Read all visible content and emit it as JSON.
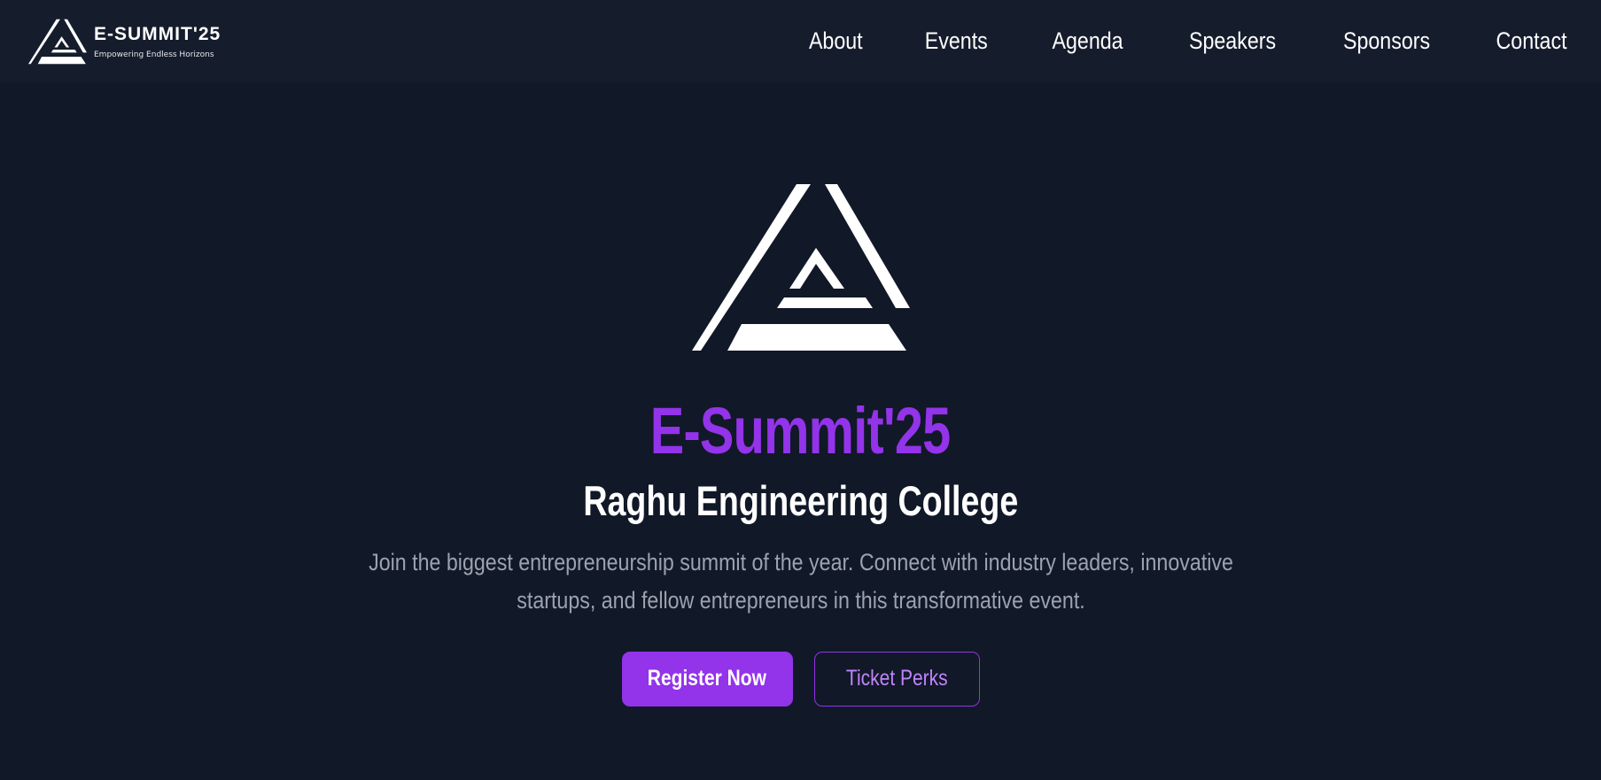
{
  "brand": {
    "title": "E-SUMMIT'25",
    "tagline": "Empowering Endless Horizons",
    "logo_icon": "triangle-logo-icon"
  },
  "nav": {
    "links": [
      "About",
      "Events",
      "Agenda",
      "Speakers",
      "Sponsors",
      "Contact"
    ]
  },
  "hero": {
    "logo_icon": "triangle-logo-icon",
    "title": "E-Summit'25",
    "subtitle": "Raghu Engineering College",
    "description_line1": "Join the biggest entrepreneurship summit of the year. Connect with industry leaders, innovative",
    "description_line2": "startups, and fellow entrepreneurs in this transformative event.",
    "primary_button": "Register Now",
    "secondary_button": "Ticket Perks"
  },
  "colors": {
    "background": "#111827",
    "navbar": "#151c2c",
    "accent": "#9333ea",
    "accent_light": "#c084fc",
    "muted_text": "#9ca3af"
  }
}
